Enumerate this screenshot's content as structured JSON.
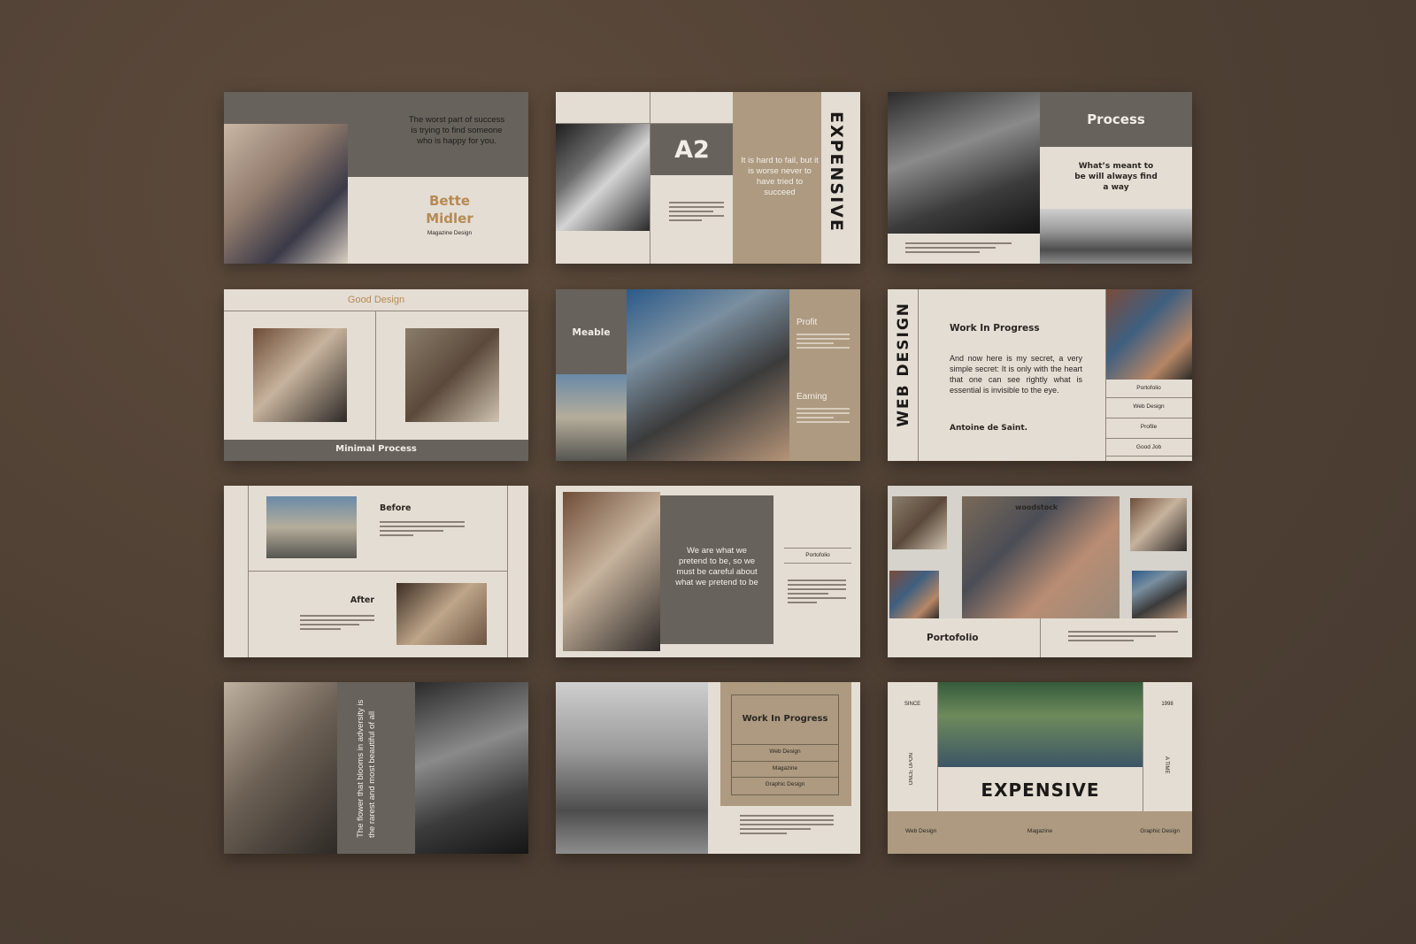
{
  "slides": {
    "s1": {
      "quote": "The worst part of success is trying to find someone who is happy for you.",
      "name_line1": "Bette",
      "name_line2": "Midler",
      "subtitle": "Magazine Design"
    },
    "s2": {
      "badge": "A2",
      "quote": "It is hard to fail, but it is worse never to have tried to succeed",
      "vertical_title": "EXPENSIVE"
    },
    "s3": {
      "title": "Process",
      "quote": "What’s meant to be will always find a way"
    },
    "s4": {
      "heading": "Good Design",
      "footer": "Minimal Process"
    },
    "s5": {
      "label": "Meable",
      "profit": "Profit",
      "earning": "Earning"
    },
    "s6": {
      "vertical_title": "WEB DESIGN",
      "title": "Work In Progress",
      "body": "And now here is my secret, a very simple secret: It is only with the heart that one can see rightly what is essential is invisible to the eye.",
      "author": "Antoine de Saint.",
      "menu": [
        "Portofolio",
        "Web Design",
        "Profile",
        "Good Job"
      ]
    },
    "s7": {
      "before": "Before",
      "after": "After"
    },
    "s8": {
      "quote": "We are what we pretend to be, so we must be careful about what we pretend to be",
      "label": "Portofolio"
    },
    "s9": {
      "title": "Portofolio",
      "brand": "woodstock"
    },
    "s10": {
      "quote": "The flower that blooms in adversity is the rarest and most beautiful of all"
    },
    "s11": {
      "title": "Work In Progress",
      "items": [
        "Web Design",
        "Magazine",
        "Graphic Design"
      ]
    },
    "s12": {
      "since": "SINCE",
      "year": "1998",
      "once_upon": "ONCE UPON",
      "a_time": "A TIME",
      "title": "EXPENSIVE",
      "footer": [
        "Web Design",
        "Magazine",
        "Graphic Design"
      ]
    }
  }
}
